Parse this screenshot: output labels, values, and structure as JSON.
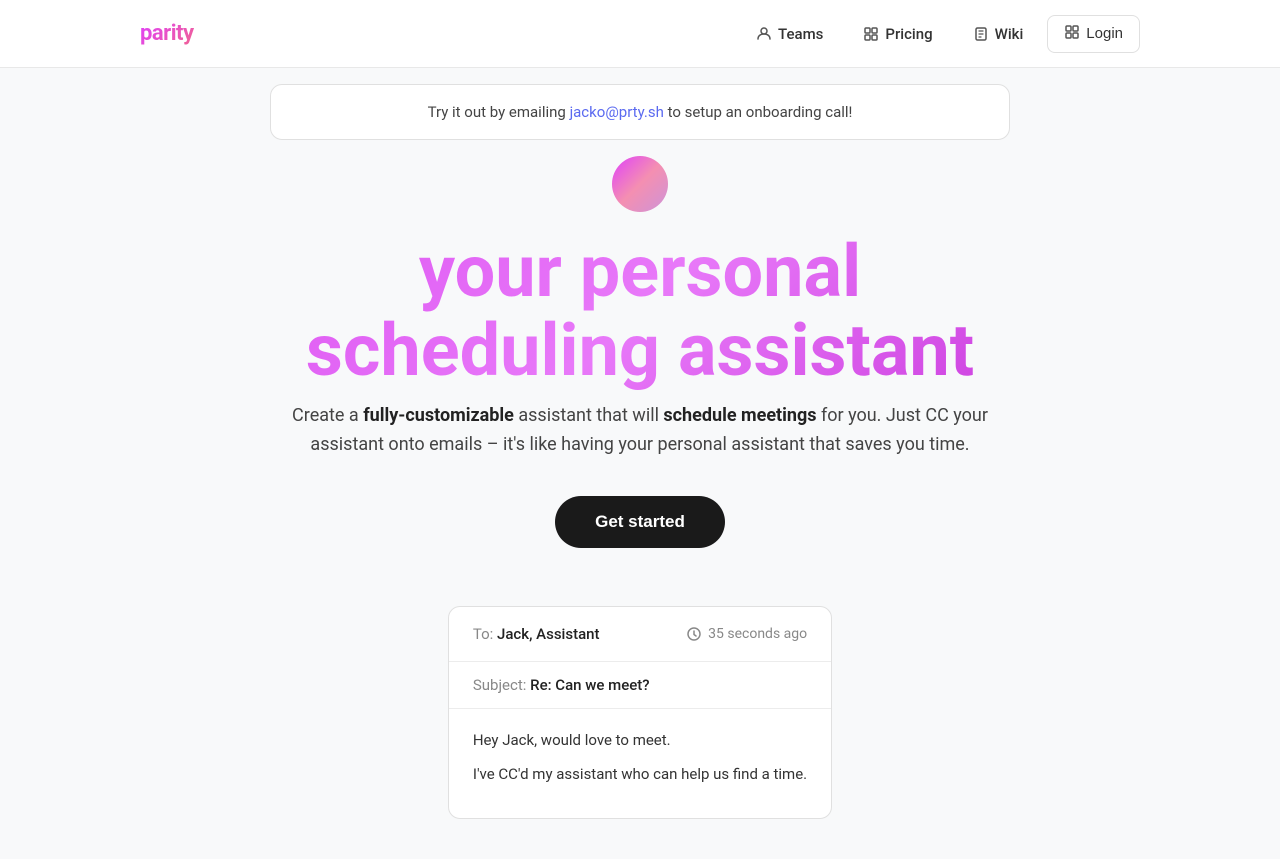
{
  "brand": {
    "logo": "parity"
  },
  "nav": {
    "items": [
      {
        "id": "teams",
        "label": "Teams",
        "icon": "person-icon"
      },
      {
        "id": "pricing",
        "label": "Pricing",
        "icon": "tag-icon"
      },
      {
        "id": "wiki",
        "label": "Wiki",
        "icon": "book-icon"
      }
    ],
    "login": {
      "label": "Login",
      "icon": "grid-icon"
    }
  },
  "banner": {
    "text_before": "Try it out by emailing ",
    "email": "jacko@prty.sh",
    "text_after": " to setup an onboarding call!"
  },
  "hero": {
    "title_line1": "your personal",
    "title_line2": "scheduling assistant",
    "description_before": "Create a ",
    "bold1": "fully-customizable",
    "description_mid": " assistant that will ",
    "bold2": "schedule meetings",
    "description_after": " for you. Just CC your assistant onto emails – it's like having your personal assistant that saves you time.",
    "cta_label": "Get started"
  },
  "email_demo": {
    "to_label": "To:",
    "to_value": "Jack, Assistant",
    "time": "35 seconds ago",
    "subject_label": "Subject:",
    "subject_value": "Re: Can we meet?",
    "body_line1": "Hey Jack, would love to meet.",
    "body_line2": "I've CC'd my assistant who can help us find a time."
  }
}
